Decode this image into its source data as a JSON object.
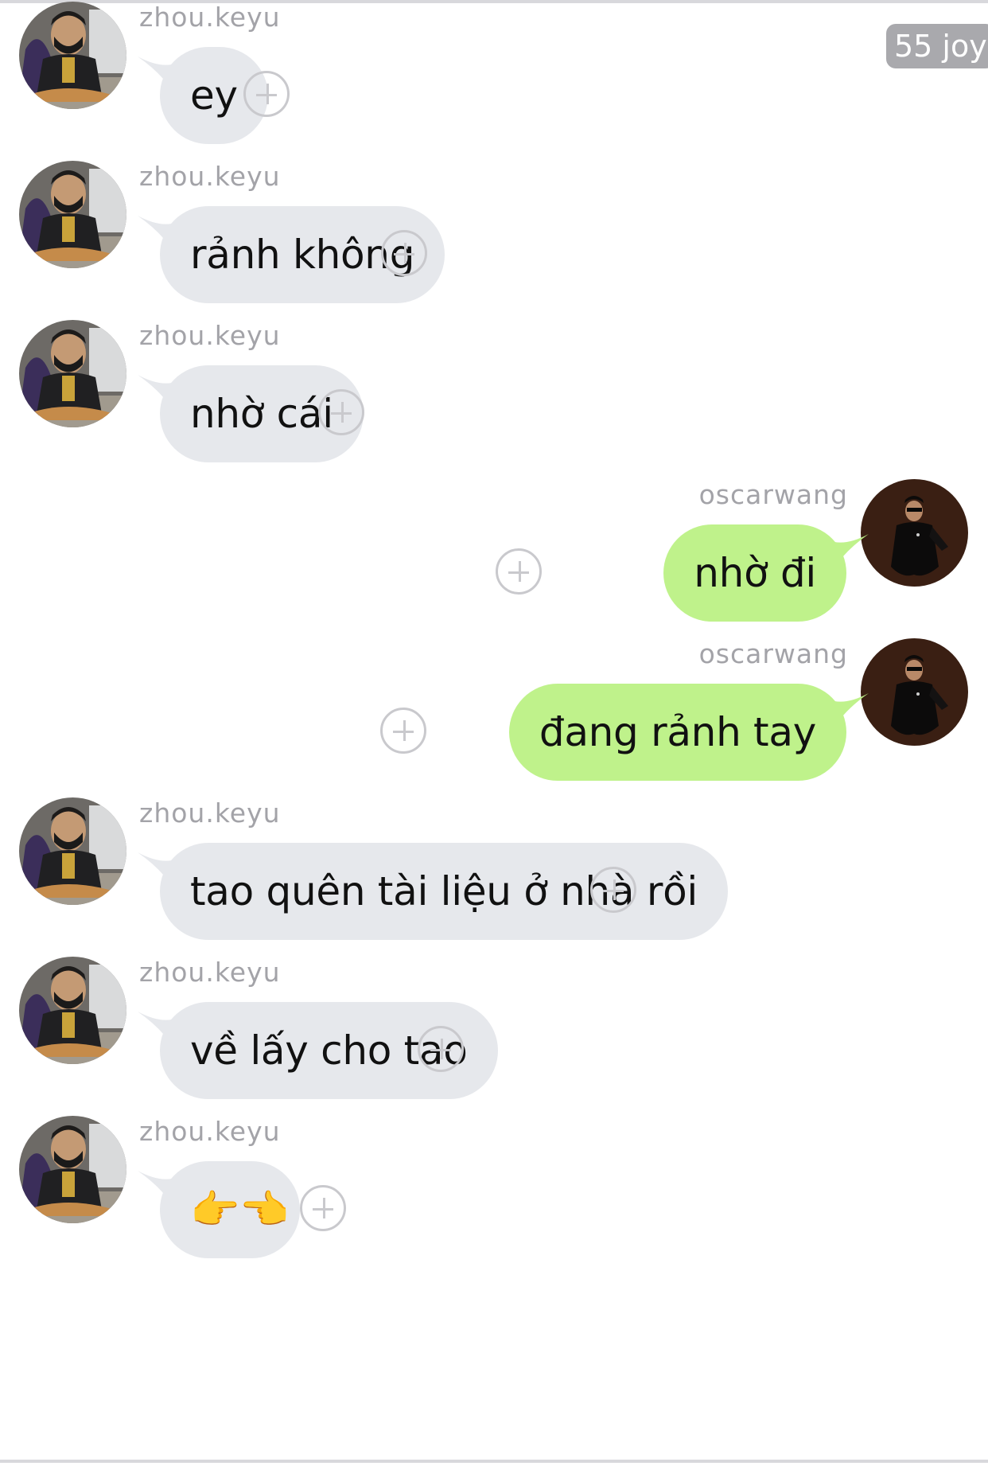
{
  "counter_badge": "55 joy",
  "icons": {
    "avatar_in": "avatar-photo-masked-man",
    "avatar_out": "avatar-photo-man-in-sunglasses",
    "reaction": "plus-circle-icon",
    "emoji_last": "pointing-fingers-emoji"
  },
  "colors": {
    "incoming_bubble": "#e6e8ec",
    "outgoing_bubble": "#bff28b",
    "username_text": "#a3a3a8",
    "badge_bg": "#a9a9ad"
  },
  "messages": [
    {
      "side": "in",
      "user": "zhou.keyu",
      "text": "ey"
    },
    {
      "side": "in",
      "user": "zhou.keyu",
      "text": "rảnh không"
    },
    {
      "side": "in",
      "user": "zhou.keyu",
      "text": "nhờ cái"
    },
    {
      "side": "out",
      "user": "oscarwang",
      "text": "nhờ đi"
    },
    {
      "side": "out",
      "user": "oscarwang",
      "text": "đang rảnh tay"
    },
    {
      "side": "in",
      "user": "zhou.keyu",
      "text": "tao quên tài liệu ở nhà rồi"
    },
    {
      "side": "in",
      "user": "zhou.keyu",
      "text": "về lấy cho tao"
    },
    {
      "side": "in",
      "user": "zhou.keyu",
      "text": "👉👈"
    }
  ]
}
